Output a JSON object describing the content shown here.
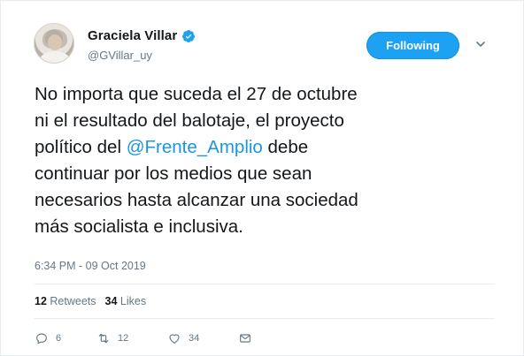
{
  "user": {
    "display_name": "Graciela Villar",
    "handle": "@GVillar_uy",
    "verified": true
  },
  "follow_button": {
    "label": "Following"
  },
  "tweet": {
    "text_before_mention": "No importa que suceda el 27 de octubre\nni el resultado del balotaje, el proyecto\npolítico del ",
    "mention": "@Frente_Amplio",
    "text_after_mention": " debe\ncontinuar por los medios que sean\nnecesarios hasta alcanzar una sociedad\nmás socialista e inclusiva.",
    "timestamp": "6:34 PM - 09 Oct 2019"
  },
  "stats": {
    "retweets_count": "12",
    "retweets_label": "Retweets",
    "likes_count": "34",
    "likes_label": "Likes"
  },
  "actions": {
    "reply_count": "6",
    "retweet_count": "12",
    "like_count": "34"
  },
  "colors": {
    "accent": "#1da1f2",
    "mention": "#1b95e0",
    "muted": "#657786",
    "text": "#14171a"
  },
  "icons": {
    "verified": "verified-badge-icon",
    "caret": "chevron-down-icon",
    "reply": "reply-icon",
    "retweet": "retweet-icon",
    "like": "heart-icon",
    "dm": "envelope-icon"
  }
}
